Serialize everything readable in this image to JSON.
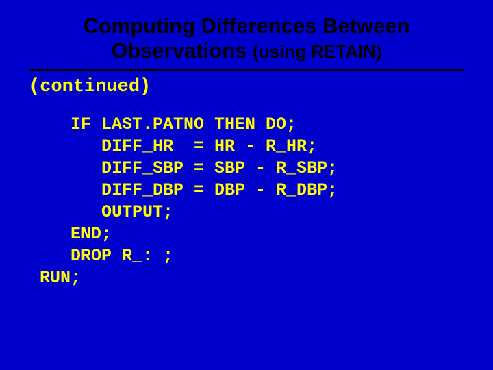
{
  "title": {
    "line1": "Computing Differences Between",
    "line2_main": "Observations ",
    "line2_paren": "(using RETAIN)"
  },
  "continued": "(continued)",
  "code": {
    "l1": "   IF LAST.PATNO THEN DO;",
    "l2": "      DIFF_HR  = HR - R_HR;",
    "l3": "      DIFF_SBP = SBP - R_SBP;",
    "l4": "      DIFF_DBP = DBP - R_DBP;",
    "l5": "      OUTPUT;",
    "l6": "   END;",
    "l7": "   DROP R_: ;",
    "l8": "RUN;"
  }
}
